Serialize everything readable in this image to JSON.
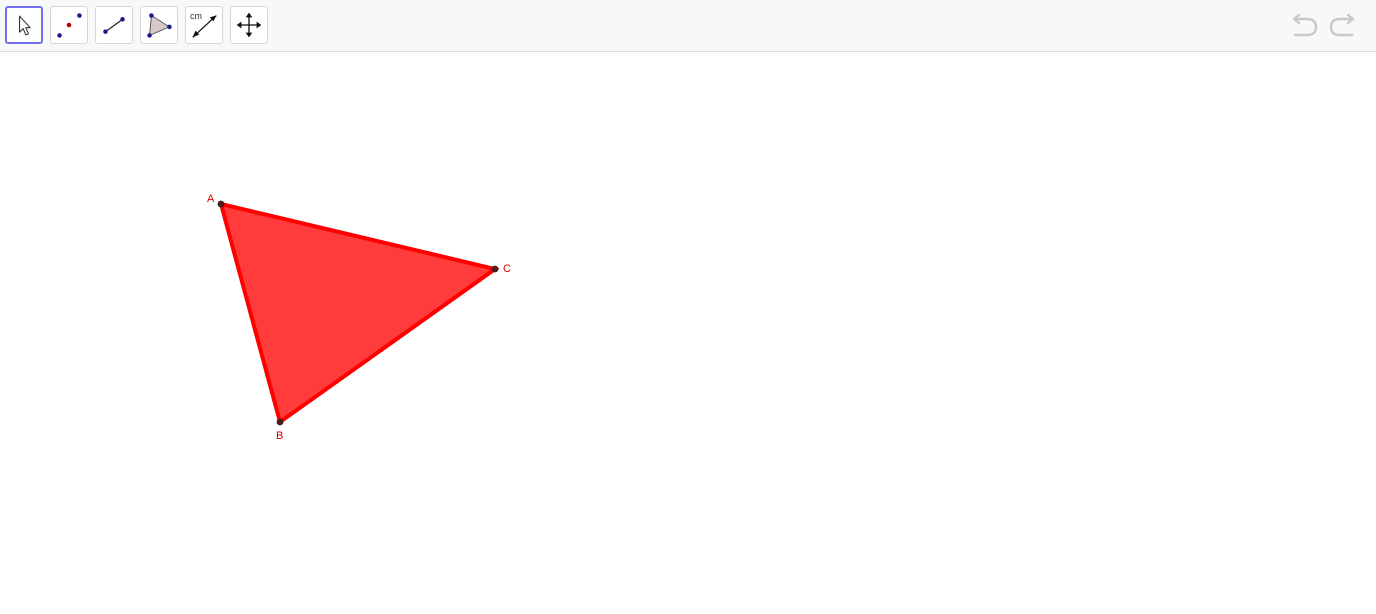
{
  "toolbar": {
    "tools": [
      {
        "icon": "move-arrow-icon",
        "active": true
      },
      {
        "icon": "point-icon",
        "active": false
      },
      {
        "icon": "segment-icon",
        "active": false
      },
      {
        "icon": "polygon-icon",
        "active": false
      },
      {
        "icon": "distance-icon",
        "unit_label": "cm",
        "active": false
      },
      {
        "icon": "move-graphics-view-icon",
        "active": false
      }
    ],
    "undo_icon": "undo-icon",
    "redo_icon": "redo-icon"
  },
  "canvas": {
    "triangle": {
      "fill_color": "#ff3b3b",
      "stroke_color": "#ff0000",
      "points": [
        {
          "label": "A"
        },
        {
          "label": "B"
        },
        {
          "label": "C"
        }
      ]
    }
  }
}
